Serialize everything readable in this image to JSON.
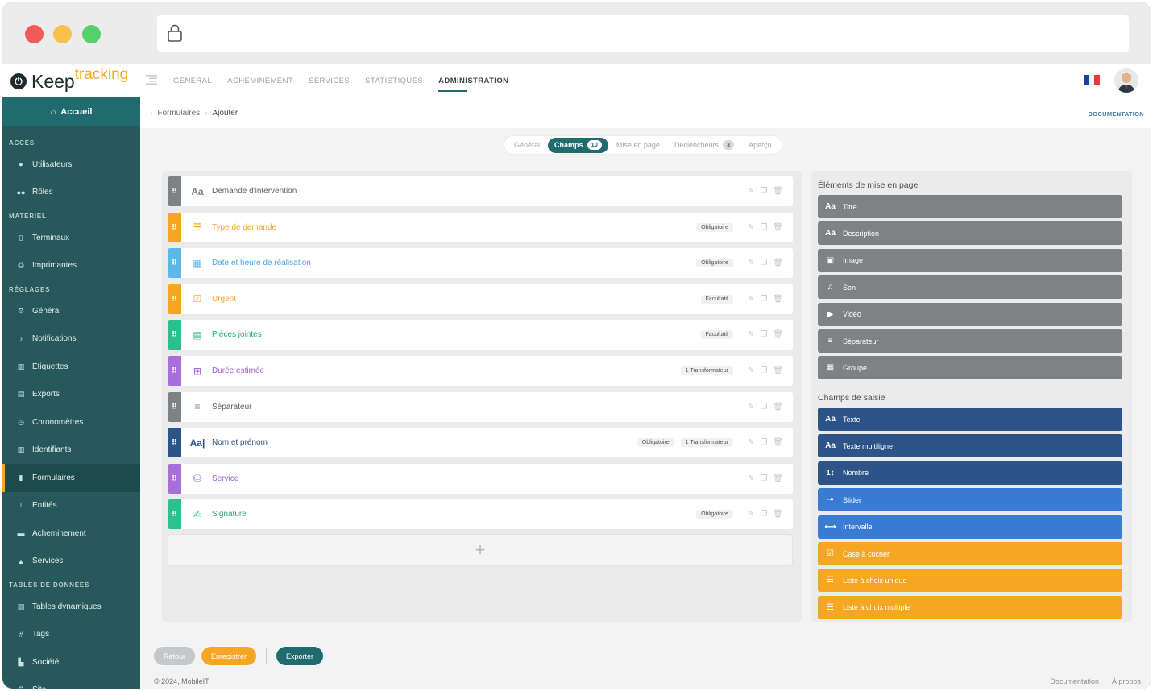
{
  "header": {
    "logo_keep": "Keep",
    "logo_tracking": "tracking",
    "nav": [
      "GÉNÉRAL",
      "ACHEMINEMENT",
      "SERVICES",
      "STATISTIQUES",
      "ADMINISTRATION"
    ],
    "active_nav": "ADMINISTRATION"
  },
  "sidebar": {
    "home": "Accueil",
    "sections": [
      {
        "title": "ACCÈS",
        "items": [
          {
            "label": "Utilisateurs",
            "icon": "user-icon"
          },
          {
            "label": "Rôles",
            "icon": "users-icon"
          }
        ]
      },
      {
        "title": "MATÉRIEL",
        "items": [
          {
            "label": "Terminaux",
            "icon": "device-icon"
          },
          {
            "label": "Imprimantes",
            "icon": "printer-icon"
          }
        ]
      },
      {
        "title": "RÉGLAGES",
        "items": [
          {
            "label": "Général",
            "icon": "gears-icon"
          },
          {
            "label": "Notifications",
            "icon": "bell-icon"
          },
          {
            "label": "Étiquettes",
            "icon": "barcode-icon"
          },
          {
            "label": "Exports",
            "icon": "file-icon"
          },
          {
            "label": "Chronomètres",
            "icon": "stopwatch-icon"
          },
          {
            "label": "Identifiants",
            "icon": "id-icon"
          },
          {
            "label": "Formulaires",
            "icon": "clipboard-icon"
          },
          {
            "label": "Entités",
            "icon": "sitemap-icon"
          },
          {
            "label": "Acheminement",
            "icon": "truck-icon"
          },
          {
            "label": "Services",
            "icon": "mountain-icon"
          }
        ]
      },
      {
        "title": "TABLES DE DONNÉES",
        "items": [
          {
            "label": "Tables dynamiques",
            "icon": "table-icon"
          },
          {
            "label": "Tags",
            "icon": "hash-icon"
          },
          {
            "label": "Société",
            "icon": "industry-icon"
          },
          {
            "label": "Site",
            "icon": "pin-icon"
          }
        ]
      }
    ],
    "active": "Formulaires"
  },
  "breadcrumb": {
    "first": "Formulaires",
    "second": "Ajouter"
  },
  "documentation": "DOCUMENTATION",
  "tabs": [
    {
      "label": "Général",
      "badge": ""
    },
    {
      "label": "Champs",
      "badge": "10"
    },
    {
      "label": "Mise en page",
      "badge": ""
    },
    {
      "label": "Déclencheurs",
      "badge": "3"
    },
    {
      "label": "Aperçu",
      "badge": ""
    }
  ],
  "fields": [
    {
      "label": "Demande d'intervention",
      "color": "#7e8284",
      "text_color": "#5b6165",
      "icon": "title-icon",
      "glyph": "Aa",
      "tags": []
    },
    {
      "label": "Type de demande",
      "color": "#f5a623",
      "text_color": "#f5a623",
      "icon": "list-icon",
      "glyph": "☰",
      "tags": [
        "Obligatoire"
      ]
    },
    {
      "label": "Date et heure de réalisation",
      "color": "#5bb8e8",
      "text_color": "#4aa8dc",
      "icon": "calendar-icon",
      "glyph": "▦",
      "tags": [
        "Obligatoire"
      ]
    },
    {
      "label": "Urgent",
      "color": "#f5a623",
      "text_color": "#f5a623",
      "icon": "checkbox-icon",
      "glyph": "☑",
      "tags": [
        "Facultatif"
      ]
    },
    {
      "label": "Pièces jointes",
      "color": "#2fbf8f",
      "text_color": "#23a77a",
      "icon": "attachment-icon",
      "glyph": "▤",
      "tags": [
        "Facultatif"
      ]
    },
    {
      "label": "Durée estimée",
      "color": "#a86fd9",
      "text_color": "#9b5fd0",
      "icon": "duration-icon",
      "glyph": "⊞",
      "tags": [
        "1 Transformateur"
      ]
    },
    {
      "label": "Séparateur",
      "color": "#7e8284",
      "text_color": "#5b6165",
      "icon": "separator-icon",
      "glyph": "≡",
      "tags": []
    },
    {
      "label": "Nom et prénom",
      "color": "#2d5489",
      "text_color": "#2d4f7e",
      "icon": "text-icon",
      "glyph": "Aa|",
      "tags": [
        "Obligatoire",
        "1 Transformateur"
      ]
    },
    {
      "label": "Service",
      "color": "#a86fd9",
      "text_color": "#9b5fd0",
      "icon": "database-icon",
      "glyph": "⛁",
      "tags": []
    },
    {
      "label": "Signature",
      "color": "#2fbf8f",
      "text_color": "#23a77a",
      "icon": "signature-icon",
      "glyph": "✍",
      "tags": [
        "Obligatoire"
      ]
    }
  ],
  "add_field": "+",
  "layout_elements": {
    "title": "Éléments de mise en page",
    "items": [
      {
        "label": "Titre",
        "icon": "title-icon",
        "glyph": "Aa"
      },
      {
        "label": "Description",
        "icon": "description-icon",
        "glyph": "Aa"
      },
      {
        "label": "Image",
        "icon": "image-icon",
        "glyph": "▣"
      },
      {
        "label": "Son",
        "icon": "music-icon",
        "glyph": "♫"
      },
      {
        "label": "Vidéo",
        "icon": "play-icon",
        "glyph": "▶"
      },
      {
        "label": "Séparateur",
        "icon": "separator-icon",
        "glyph": "≡"
      },
      {
        "label": "Groupe",
        "icon": "group-icon",
        "glyph": "▦"
      }
    ]
  },
  "input_fields": {
    "title": "Champs de saisie",
    "items": [
      {
        "label": "Texte",
        "icon": "text-icon",
        "glyph": "Aa",
        "style": "navy"
      },
      {
        "label": "Texte multiligne",
        "icon": "multiline-text-icon",
        "glyph": "Aa",
        "style": "navy"
      },
      {
        "label": "Nombre",
        "icon": "number-icon",
        "glyph": "1↕",
        "style": "navy"
      },
      {
        "label": "Slider",
        "icon": "slider-icon",
        "glyph": "⊸",
        "style": "blue"
      },
      {
        "label": "Intervalle",
        "icon": "range-icon",
        "glyph": "⟷",
        "style": "blue"
      },
      {
        "label": "Case à cocher",
        "icon": "checkbox-icon",
        "glyph": "☑",
        "style": "orange"
      },
      {
        "label": "Liste à choix unique",
        "icon": "list-icon",
        "glyph": "☰",
        "style": "orange"
      },
      {
        "label": "Liste à choix multiple",
        "icon": "multi-list-icon",
        "glyph": "☰",
        "style": "orange"
      }
    ]
  },
  "footer": {
    "back": "Retour",
    "save": "Enregistrer",
    "export": "Exporter",
    "copyright": "© 2024, MobileIT",
    "links": [
      "Documentation",
      "À propos"
    ]
  }
}
